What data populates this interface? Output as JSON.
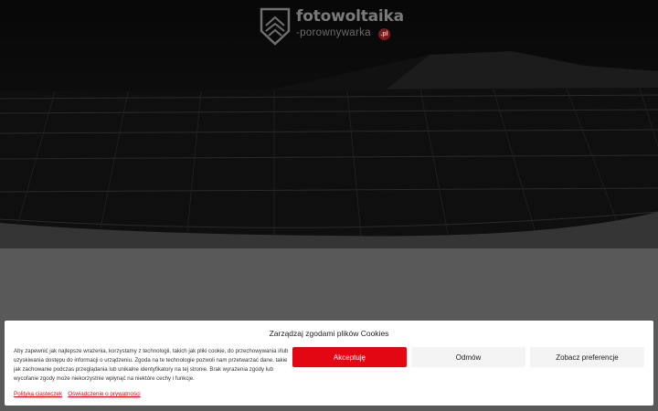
{
  "site": {
    "brand_main": "fotowoltaika",
    "brand_sub": "-porownywarka",
    "brand_tld": ".pl",
    "logo_icon": "house-shield-logo-icon"
  },
  "cookie_banner": {
    "title": "Zarządzaj zgodami plików Cookies",
    "message": "Aby zapewnić jak najlepsze wrażenia, korzystamy z technologii, takich jak pliki cookie, do przechowywania i/lub uzyskiwania dostępu do informacji o urządzeniu. Zgoda na te technologie pozwoli nam przetwarzać dane, takie jak zachowanie podczas przeglądania lub unikalne identyfikatory na tej stronie. Brak wyrażenia zgody lub wycofanie zgody może niekorzystnie wpłynąć na niektóre cechy i funkcje.",
    "buttons": {
      "accept": "Akceptuję",
      "deny": "Odmów",
      "preferences": "Zobacz preferencje"
    },
    "links": {
      "cookie_policy": "Polityka ciasteczek",
      "privacy_statement": "Oświadczenie o prywatności"
    }
  },
  "colors": {
    "accent": "#e30613",
    "overlay_bg": "#595959",
    "banner_bg": "#ffffff"
  }
}
